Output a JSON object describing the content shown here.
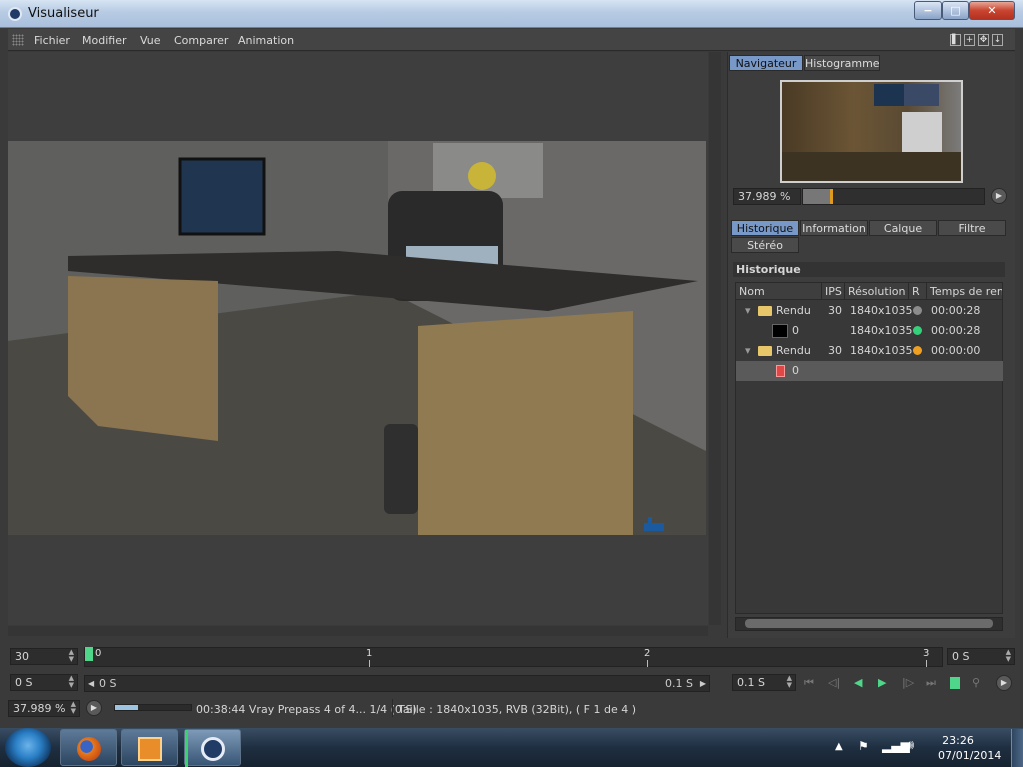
{
  "window": {
    "title": "Visualiseur",
    "min": "−",
    "max": "□",
    "close": "✕"
  },
  "menu": [
    "Fichier",
    "Modifier",
    "Vue",
    "Comparer",
    "Animation"
  ],
  "toolbar_icons": [
    "layout-icon",
    "new-window-icon",
    "move-icon",
    "arrow-down-icon"
  ],
  "navigator": {
    "tabs": [
      "Navigateur",
      "Histogramme"
    ],
    "zoom": "37.989 %"
  },
  "history_tabs": [
    "Historique",
    "Information",
    "Calque",
    "Filtre",
    "Stéréo"
  ],
  "history": {
    "header": "Historique",
    "columns": [
      "Nom",
      "IPS",
      "Résolution",
      "R",
      "Temps de rend"
    ],
    "rows": [
      {
        "name": "Rendu",
        "ips": "30",
        "resolution": "1840x1035",
        "status_color": "#8c8c8c",
        "time": "00:00:28",
        "type": "folder",
        "indent": 0
      },
      {
        "name": "0",
        "ips": "",
        "resolution": "1840x1035",
        "status_color": "#35d07a",
        "time": "00:00:28",
        "type": "image",
        "indent": 1
      },
      {
        "name": "Rendu",
        "ips": "30",
        "resolution": "1840x1035",
        "status_color": "#f0a020",
        "time": "00:00:00",
        "type": "folder",
        "indent": 0
      },
      {
        "name": "0",
        "ips": "",
        "resolution": "",
        "status_color": "",
        "time": "",
        "type": "image-red",
        "indent": 1
      }
    ]
  },
  "timeline": {
    "fps": "30",
    "ticks": [
      "0",
      "1",
      "2",
      "3"
    ],
    "end_field": "0 S",
    "start_field": "0 S",
    "range_start": "0 S",
    "range_end": "0.1 S",
    "step_field": "0.1 S"
  },
  "status": {
    "zoom": "37.989 %",
    "progress_fraction": 0.3,
    "text": "00:38:44 Vray Prepass 4 of 4... 1/4 (0 S)",
    "info": "Taille : 1840x1035, RVB (32Bit),  ( F 1 de 4 )"
  },
  "taskbar": {
    "time": "23:26",
    "date": "07/01/2014",
    "apps": [
      "firefox-icon",
      "media-player-icon",
      "cinema4d-icon"
    ]
  }
}
